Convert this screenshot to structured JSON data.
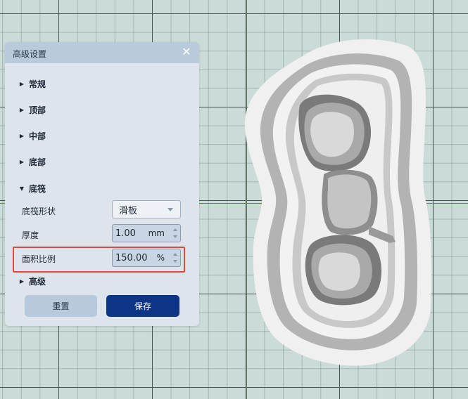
{
  "panel": {
    "title": "高级设置",
    "close_symbol": "✕",
    "sections": [
      {
        "label": "常规",
        "expanded": false
      },
      {
        "label": "顶部",
        "expanded": false
      },
      {
        "label": "中部",
        "expanded": false
      },
      {
        "label": "底部",
        "expanded": false
      },
      {
        "label": "底筏",
        "expanded": true
      },
      {
        "label": "高级",
        "expanded": false
      }
    ],
    "raft": {
      "shape_label": "底筏形状",
      "shape_value": "滑板",
      "thickness_label": "厚度",
      "thickness_value": "1.00",
      "thickness_unit": "mm",
      "area_label": "面积比例",
      "area_value": "150.00",
      "area_unit": "%"
    },
    "buttons": {
      "reset": "重置",
      "save": "保存"
    }
  },
  "colors": {
    "highlight": "#e0493a",
    "save_button": "#0e3488",
    "grid_background": "#cbdcd8"
  }
}
